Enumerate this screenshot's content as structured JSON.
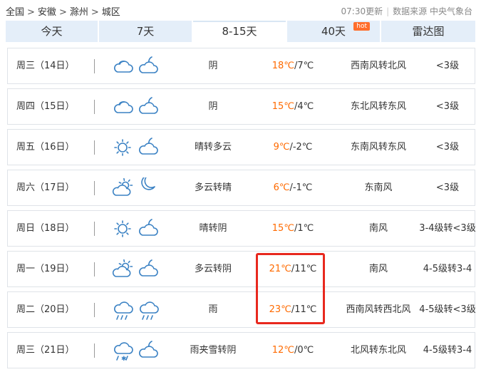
{
  "breadcrumb": [
    "全国",
    "安徽",
    "滁州",
    "城区"
  ],
  "breadcrumb_sep": ">",
  "update_time": "07:30更新",
  "source": "数据来源 中央气象台",
  "tabs": [
    {
      "label": "今天"
    },
    {
      "label": "7天"
    },
    {
      "label": "8-15天",
      "active": true
    },
    {
      "label": "40天",
      "badge": "hot"
    },
    {
      "label": "雷达图"
    }
  ],
  "colors": {
    "high_temp": "#ff6a00",
    "icon_stroke": "#3b82c4",
    "sun": "#f5a623",
    "highlight": "#e8281e",
    "tab_bg": "#e4eef9"
  },
  "forecast": [
    {
      "day": "周三（14日）",
      "icons": [
        "cloudy-icon",
        "partly-cloudy-night-icon"
      ],
      "condition": "阴",
      "high": "18℃",
      "low": "/7℃",
      "wind": "西南风转北风",
      "level": "<3级"
    },
    {
      "day": "周四（15日）",
      "icons": [
        "cloudy-icon",
        "partly-cloudy-night-icon"
      ],
      "condition": "阴",
      "high": "15℃",
      "low": "/4℃",
      "wind": "东北风转东风",
      "level": "<3级"
    },
    {
      "day": "周五（16日）",
      "icons": [
        "sunny-icon",
        "partly-cloudy-night-icon"
      ],
      "condition": "晴转多云",
      "high": "9℃",
      "low": "/-2℃",
      "wind": "东南风转东风",
      "level": "<3级"
    },
    {
      "day": "周六（17日）",
      "icons": [
        "partly-cloudy-day-icon",
        "moon-icon"
      ],
      "condition": "多云转晴",
      "high": "6℃",
      "low": "/-1℃",
      "wind": "东南风",
      "level": "<3级"
    },
    {
      "day": "周日（18日）",
      "icons": [
        "sunny-icon",
        "partly-cloudy-night-icon"
      ],
      "condition": "晴转阴",
      "high": "15℃",
      "low": "/1℃",
      "wind": "南风",
      "level": "3-4级转<3级"
    },
    {
      "day": "周一（19日）",
      "icons": [
        "partly-cloudy-day-icon",
        "partly-cloudy-night-icon"
      ],
      "condition": "多云转阴",
      "high": "21℃",
      "low": "/11℃",
      "wind": "南风",
      "level": "4-5级转3-4"
    },
    {
      "day": "周二（20日）",
      "icons": [
        "rain-icon",
        "rain-icon"
      ],
      "condition": "雨",
      "high": "23℃",
      "low": "/11℃",
      "wind": "西南风转西北风",
      "level": "4-5级转<3级"
    },
    {
      "day": "周三（21日）",
      "icons": [
        "sleet-icon",
        "partly-cloudy-night-icon"
      ],
      "condition": "雨夹雪转阴",
      "high": "12℃",
      "low": "/0℃",
      "wind": "北风转东北风",
      "level": "4-5级转3-4"
    }
  ]
}
